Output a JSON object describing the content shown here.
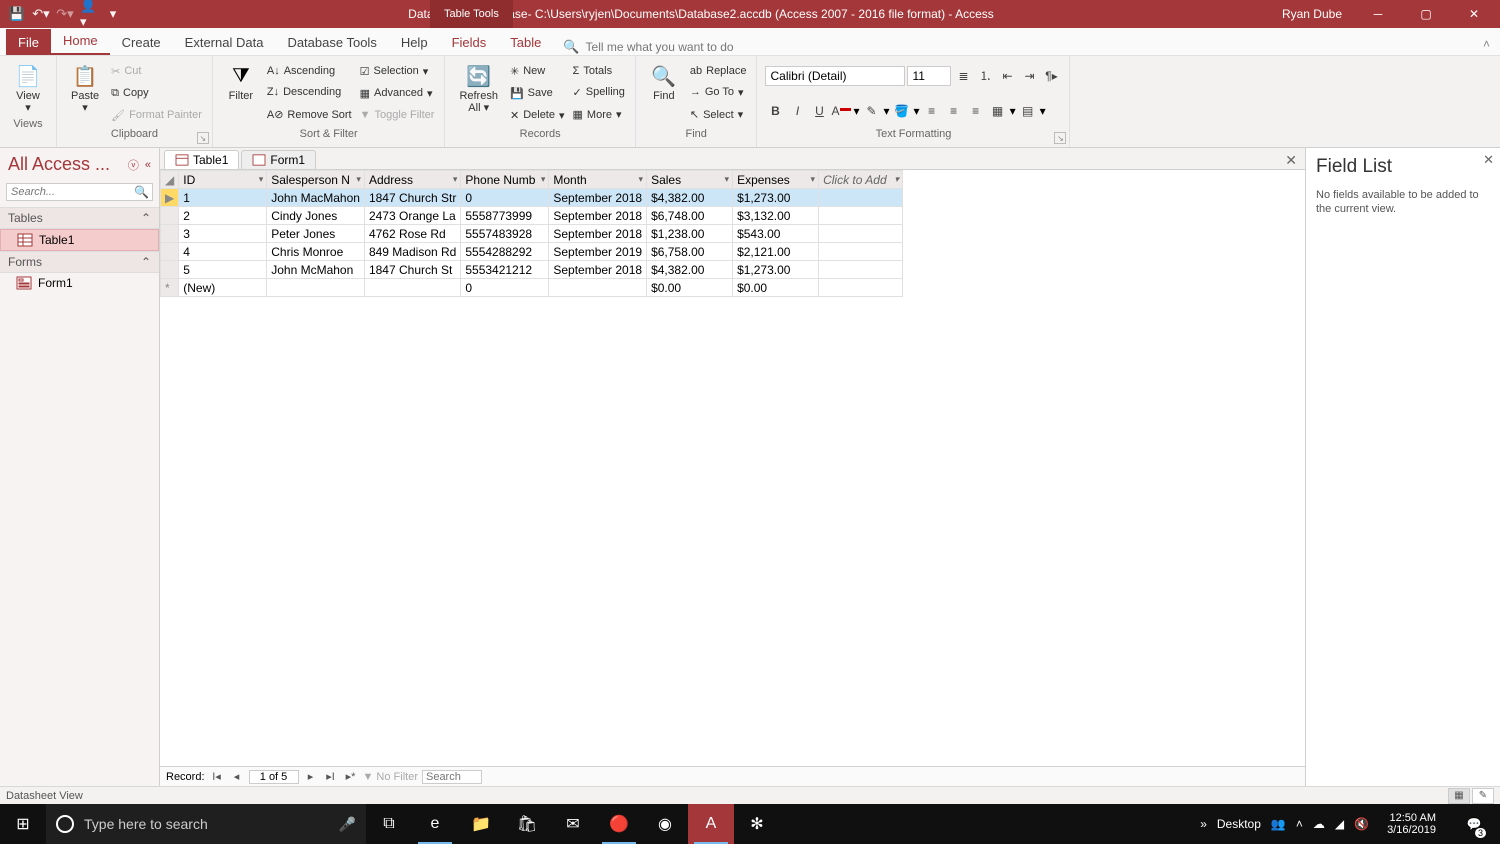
{
  "titlebar": {
    "table_tools": "Table Tools",
    "title": "Database2 : Database- C:\\Users\\ryjen\\Documents\\Database2.accdb (Access 2007 - 2016 file format)  -  Access",
    "user": "Ryan Dube"
  },
  "ribbon_tabs": {
    "file": "File",
    "home": "Home",
    "create": "Create",
    "external": "External Data",
    "dbtools": "Database Tools",
    "help": "Help",
    "fields": "Fields",
    "table": "Table",
    "tellme": "Tell me what you want to do"
  },
  "ribbon": {
    "views": {
      "view": "View",
      "group": "Views"
    },
    "clipboard": {
      "paste": "Paste",
      "cut": "Cut",
      "copy": "Copy",
      "fmtpainter": "Format Painter",
      "group": "Clipboard"
    },
    "sortfilter": {
      "filter": "Filter",
      "asc": "Ascending",
      "desc": "Descending",
      "remove": "Remove Sort",
      "selection": "Selection",
      "advanced": "Advanced",
      "toggle": "Toggle Filter",
      "group": "Sort & Filter"
    },
    "records": {
      "refresh": "Refresh\nAll",
      "new": "New",
      "save": "Save",
      "delete": "Delete",
      "totals": "Totals",
      "spelling": "Spelling",
      "more": "More",
      "group": "Records"
    },
    "find": {
      "find": "Find",
      "replace": "Replace",
      "goto": "Go To",
      "select": "Select",
      "group": "Find"
    },
    "textfmt": {
      "font": "Calibri (Detail)",
      "size": "11",
      "group": "Text Formatting"
    }
  },
  "navpane": {
    "header": "All Access ...",
    "search_placeholder": "Search...",
    "tables_hdr": "Tables",
    "table1": "Table1",
    "forms_hdr": "Forms",
    "form1": "Form1"
  },
  "doctabs": {
    "table1": "Table1",
    "form1": "Form1"
  },
  "columns": {
    "id": "ID",
    "salesperson": "Salesperson N",
    "address": "Address",
    "phone": "Phone Numb",
    "month": "Month",
    "sales": "Sales",
    "expenses": "Expenses",
    "add": "Click to Add"
  },
  "rows": [
    {
      "id": "1",
      "name": "John MacMahon",
      "addr": "1847 Church Str",
      "phone": "0",
      "month": "September 2018",
      "sales": "$4,382.00",
      "exp": "$1,273.00"
    },
    {
      "id": "2",
      "name": "Cindy Jones",
      "addr": "2473 Orange La",
      "phone": "5558773999",
      "month": "September 2018",
      "sales": "$6,748.00",
      "exp": "$3,132.00"
    },
    {
      "id": "3",
      "name": "Peter Jones",
      "addr": "4762 Rose Rd",
      "phone": "5557483928",
      "month": "September 2018",
      "sales": "$1,238.00",
      "exp": "$543.00"
    },
    {
      "id": "4",
      "name": "Chris Monroe",
      "addr": "849 Madison Rd",
      "phone": "5554288292",
      "month": "September 2019",
      "sales": "$6,758.00",
      "exp": "$2,121.00"
    },
    {
      "id": "5",
      "name": "John McMahon",
      "addr": "1847 Church St",
      "phone": "5553421212",
      "month": "September 2018",
      "sales": "$4,382.00",
      "exp": "$1,273.00"
    }
  ],
  "newrow": {
    "label": "(New)",
    "phone": "0",
    "sales": "$0.00",
    "exp": "$0.00"
  },
  "recordnav": {
    "label": "Record:",
    "pos": "1 of 5",
    "nofilter": "No Filter",
    "search": "Search"
  },
  "fieldlist": {
    "title": "Field List",
    "msg": "No fields available to be added to the current view."
  },
  "statusbar": {
    "view": "Datasheet View"
  },
  "taskbar": {
    "search_placeholder": "Type here to search",
    "desktop": "Desktop",
    "time": "12:50 AM",
    "date": "3/16/2019",
    "notif_count": "3"
  }
}
